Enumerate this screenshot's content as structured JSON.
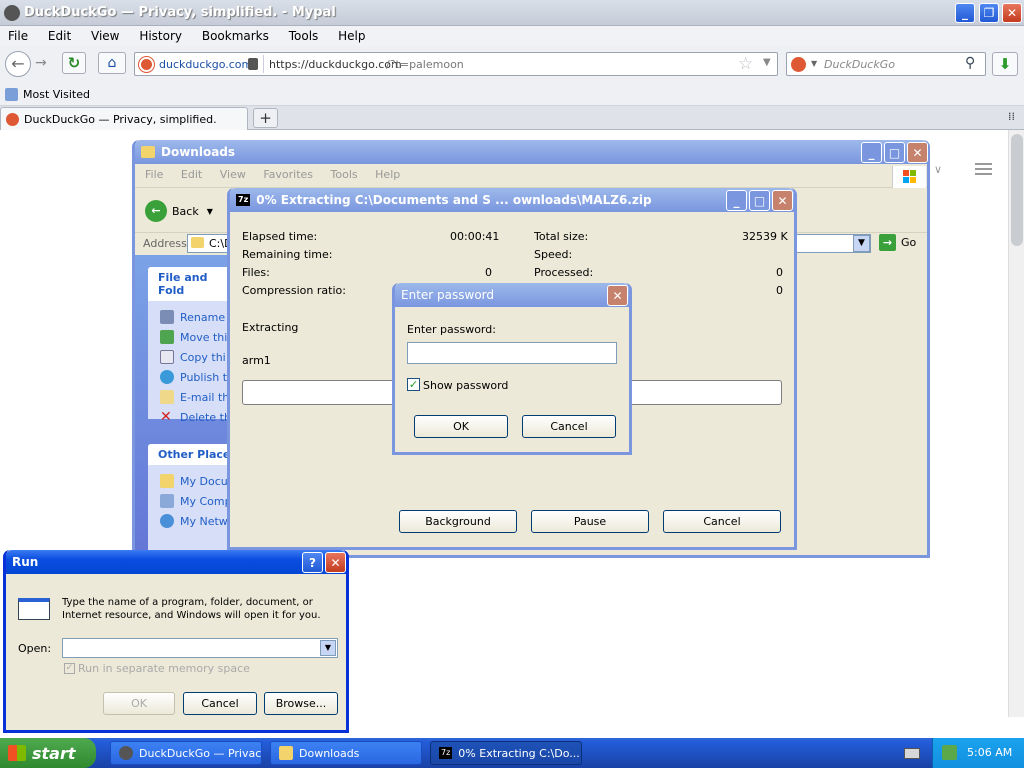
{
  "browser": {
    "title": "DuckDuckGo — Privacy, simplified. - Mypal",
    "menu": [
      "File",
      "Edit",
      "View",
      "History",
      "Bookmarks",
      "Tools",
      "Help"
    ],
    "identity": "duckduckgo.com",
    "url_host": "https://duckduckgo.com",
    "url_path": "/?t=palemoon",
    "search_placeholder": "DuckDuckGo",
    "bookmark": "Most Visited",
    "tab": "DuckDuckGo — Privacy, simplified."
  },
  "downloads": {
    "title": "Downloads",
    "menu": [
      "File",
      "Edit",
      "View",
      "Favorites",
      "Tools",
      "Help"
    ],
    "back": "Back",
    "address_label": "Address",
    "address_value": "C:\\D",
    "go": "Go",
    "file_tasks_header": "File and Fold",
    "file_tasks": [
      "Rename thi",
      "Move thi",
      "Copy thi",
      "Publish th",
      "E-mail th",
      "Delete th"
    ],
    "other_header": "Other Place",
    "other_places": [
      "My Docu",
      "My Comp",
      "My Netw"
    ]
  },
  "extract": {
    "title": "0% Extracting C:\\Documents and S ... ownloads\\MALZ6.zip",
    "elapsed_label": "Elapsed time:",
    "elapsed_value": "00:00:41",
    "remaining_label": "Remaining time:",
    "files_label": "Files:",
    "files_value": "0",
    "ratio_label": "Compression ratio:",
    "total_label": "Total size:",
    "total_value": "32539 K",
    "speed_label": "Speed:",
    "processed_label": "Processed:",
    "processed_value": "0",
    "fourth_value": "0",
    "extracting_label": "Extracting",
    "current_file": "arm1",
    "progress": 0,
    "background_btn": "Background",
    "pause_btn": "Pause",
    "cancel_btn": "Cancel"
  },
  "password": {
    "title": "Enter password",
    "label": "Enter password:",
    "value": "",
    "show_label": "Show password",
    "show_checked": true,
    "ok": "OK",
    "cancel": "Cancel"
  },
  "run": {
    "title": "Run",
    "help": "?",
    "description": "Type the name of a program, folder, document, or Internet resource, and Windows will open it for you.",
    "open_label": "Open:",
    "open_value": "",
    "separate_label": "Run in separate memory space",
    "ok": "OK",
    "cancel": "Cancel",
    "browse": "Browse..."
  },
  "taskbar": {
    "start": "start",
    "items": [
      "DuckDuckGo — Privac...",
      "Downloads",
      "0% Extracting C:\\Do..."
    ],
    "clock": "5:06 AM"
  }
}
